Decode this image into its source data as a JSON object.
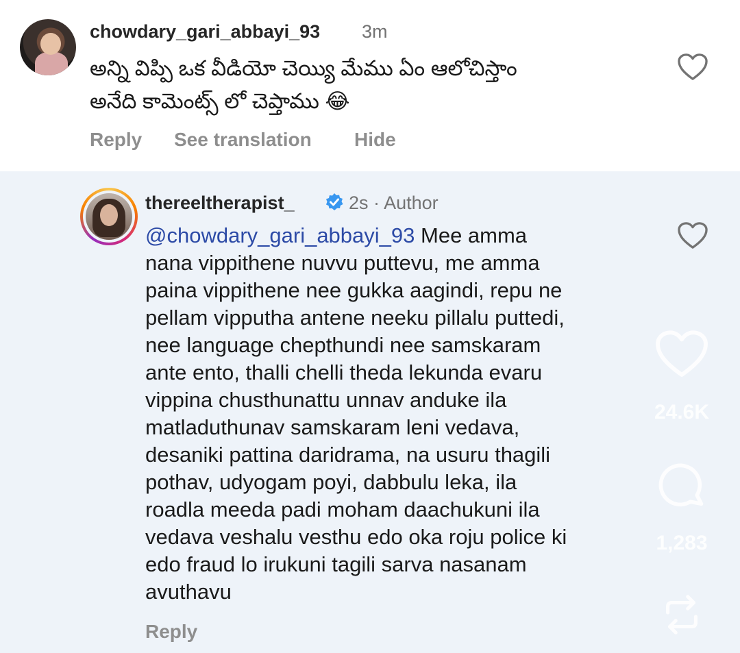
{
  "comment": {
    "username": "chowdary_gari_abbayi_93",
    "time": "3m",
    "text_line1": "అన్ని విప్పి ఒక వీడియో చెయ్యి మేము ఏం ఆలోచిస్తాం",
    "text_line2": "అనేది కామెంట్స్ లో చెప్తాము 😂",
    "actions": {
      "reply": "Reply",
      "see_translation": "See translation",
      "hide": "Hide"
    }
  },
  "reply": {
    "username": "thereeltherapist_",
    "time": "2s",
    "separator": "·",
    "author_badge": "Author",
    "mention": "@chowdary_gari_abbayi_93",
    "lines": [
      " Mee amma",
      "nana vippithene nuvvu puttevu, me amma",
      "paina vippithene nee gukka aagindi, repu ne",
      "pellam vipputha antene neeku pillalu puttedi,",
      "nee language chepthundi nee samskaram",
      "ante ento, thalli chelli theda lekunda evaru",
      "vippina chusthunattu unnav anduke ila",
      "matladuthunav samskaram leni vedava,",
      "desaniki pattina daridrama, na usuru thagili",
      "pothav, udyogam poyi, dabbulu leka, ila",
      "roadla meeda padi moham daachukuni ila",
      "vedava veshalu vesthu edo oka roju police ki",
      "edo fraud lo irukuni tagili sarva nasanam",
      "avuthavu"
    ],
    "reply_label": "Reply"
  },
  "overlay": {
    "likes": "24.6K",
    "comments": "1,283"
  },
  "icons": [
    "heart-icon",
    "verified-icon",
    "comment-icon",
    "repost-icon"
  ],
  "colors": {
    "mention": "#2c4aa6",
    "verified": "#3897f0",
    "reply_bg": "#eef3f9"
  }
}
